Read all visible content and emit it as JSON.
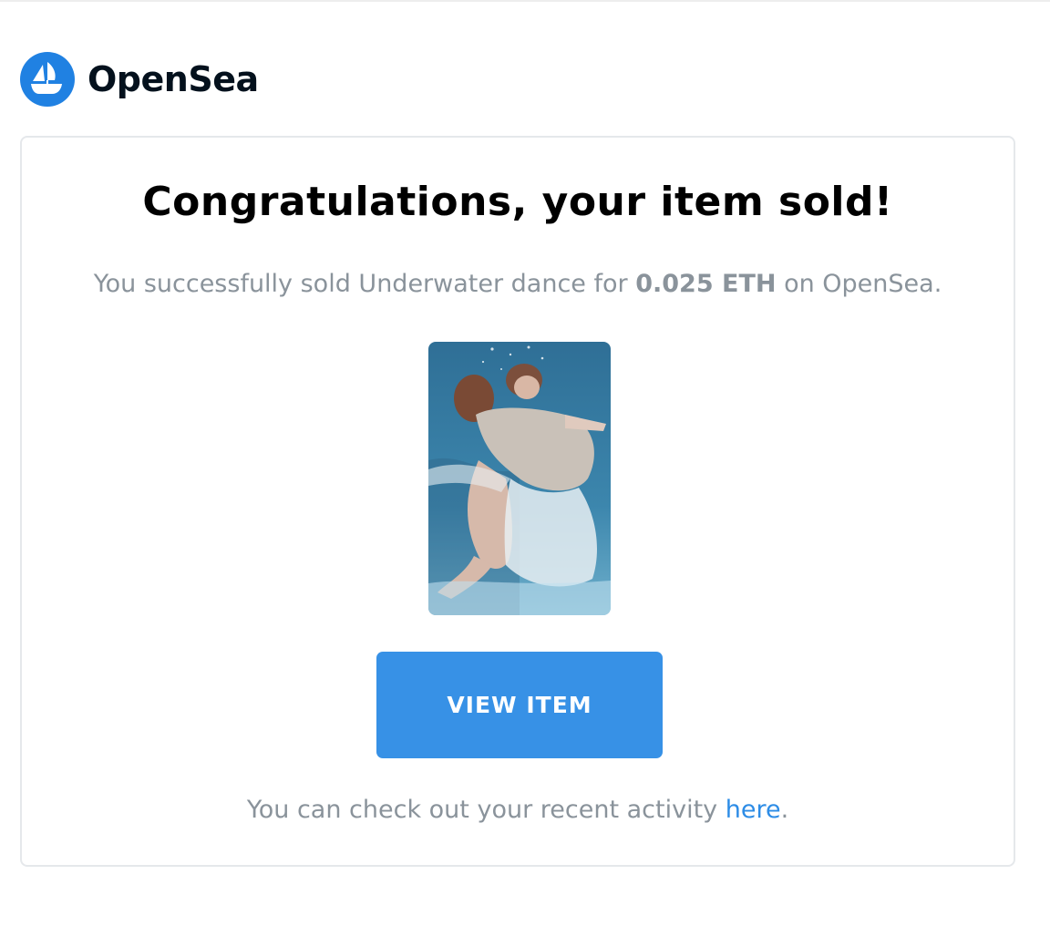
{
  "brand": {
    "name": "OpenSea",
    "logo_icon": "opensea-boat-icon",
    "logo_color": "#2081e2"
  },
  "email": {
    "heading": "Congratulations, your item sold!",
    "sale_prefix": "You successfully sold Underwater dance for ",
    "sale_amount": "0.025 ETH",
    "sale_suffix": " on OpenSea.",
    "item_image": "underwater-dance-artwork",
    "button_label": "VIEW ITEM",
    "button_color": "#3791e6",
    "activity_prefix": "You can check out your recent activity ",
    "activity_link": "here",
    "activity_suffix": ".",
    "link_color": "#2d8ce6",
    "muted_text_color": "#8a939b"
  }
}
